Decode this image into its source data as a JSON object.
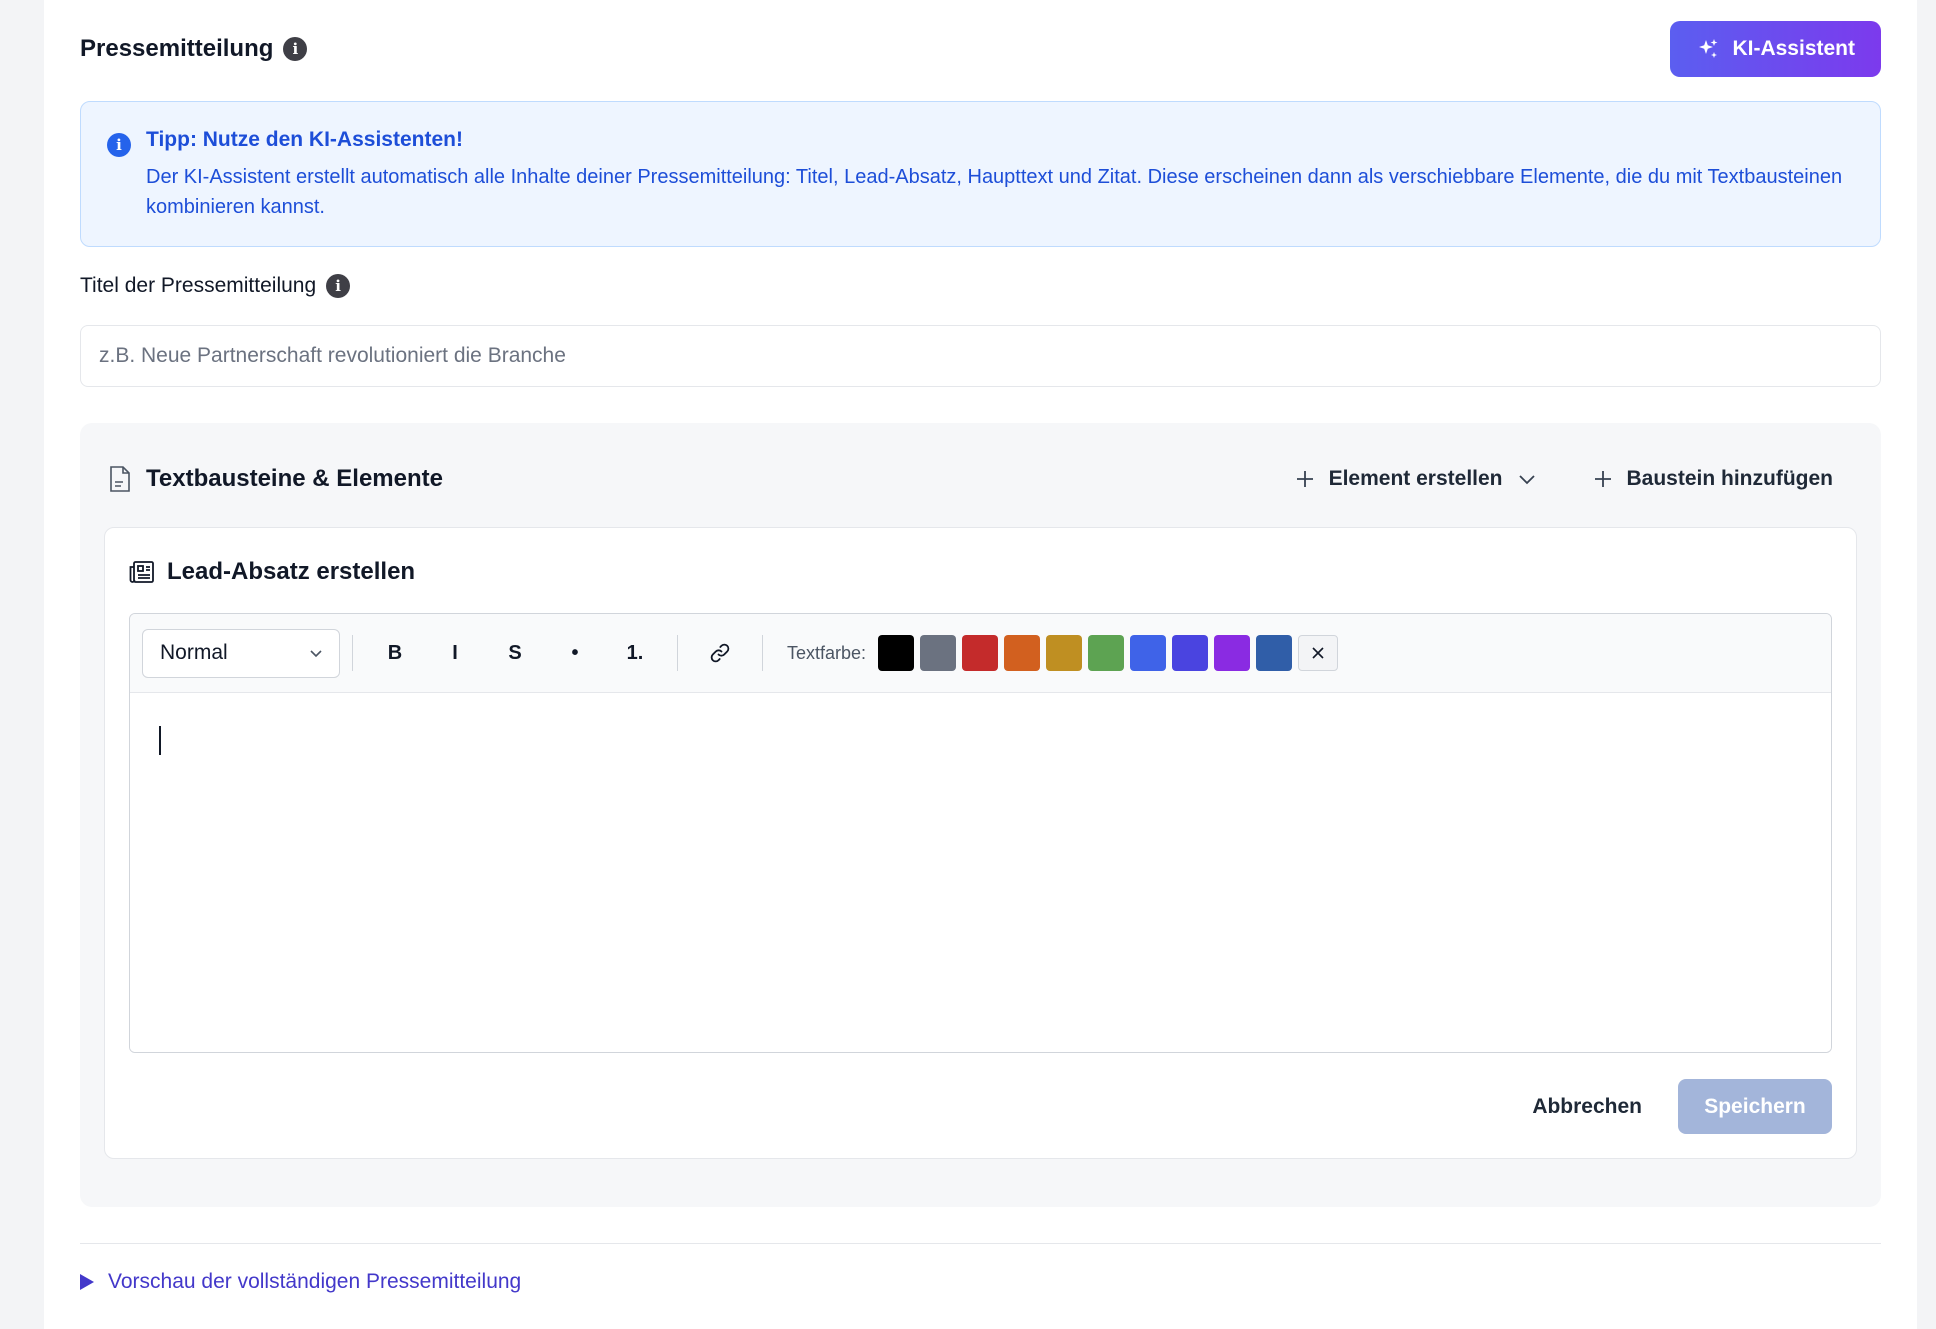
{
  "header": {
    "title": "Pressemitteilung",
    "ai_button_label": "KI-Assistent"
  },
  "tip": {
    "title": "Tipp: Nutze den KI-Assistenten!",
    "text": "Der KI-Assistent erstellt automatisch alle Inhalte deiner Pressemitteilung: Titel, Lead-Absatz, Haupttext und Zitat. Diese erscheinen dann als verschiebbare Elemente, die du mit Textbausteinen kombinieren kannst."
  },
  "title_field": {
    "label": "Titel der Pressemitteilung",
    "placeholder": "z.B. Neue Partnerschaft revolutioniert die Branche",
    "value": ""
  },
  "blocks": {
    "title": "Textbausteine & Elemente",
    "create_element_label": "Element erstellen",
    "add_block_label": "Baustein hinzufügen"
  },
  "editor_card": {
    "title": "Lead-Absatz erstellen",
    "format_select": "Normal",
    "toolbar": {
      "bold": "B",
      "italic": "I",
      "strike": "S",
      "bullet": "•",
      "ordered": "1."
    },
    "color_label": "Textfarbe:",
    "colors": [
      "#000000",
      "#6b7280",
      "#c42b2b",
      "#d2601f",
      "#bf8f22",
      "#5da352",
      "#3f63e8",
      "#4a44e0",
      "#8a2be2",
      "#305ea8"
    ],
    "content": "",
    "cancel_label": "Abbrechen",
    "save_label": "Speichern"
  },
  "preview": {
    "label": "Vorschau der vollständigen Pressemitteilung"
  },
  "theme": {
    "accent": "#4338ca",
    "tip_text": "#1d4ed8",
    "ai_gradient_start": "#5b5ef0",
    "ai_gradient_end": "#7c3aed"
  }
}
